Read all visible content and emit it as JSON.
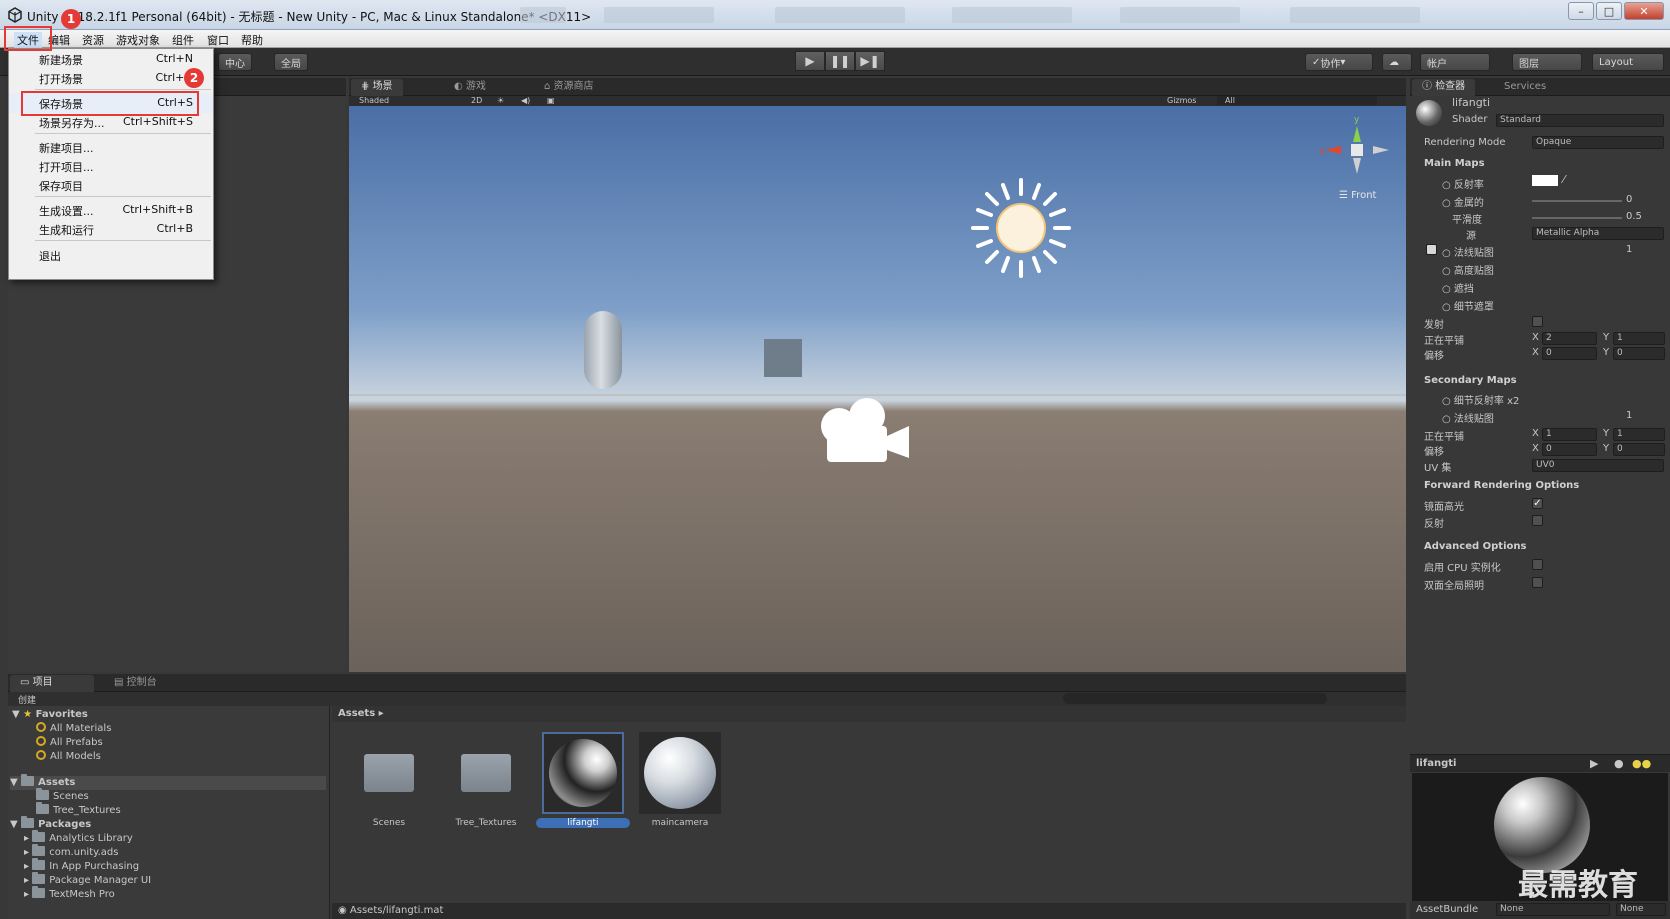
{
  "title_bar": {
    "title": "Unity 2018.2.1f1 Personal (64bit) - 无标题 - New Unity - PC, Mac & Linux Standalone* <DX11>"
  },
  "menu_bar": {
    "items": [
      "文件",
      "编辑",
      "资源",
      "游戏对象",
      "组件",
      "窗口",
      "帮助"
    ]
  },
  "annotations": {
    "step1": "1",
    "step2": "2"
  },
  "file_menu": {
    "items": [
      {
        "label": "新建场景",
        "shortcut": "Ctrl+N"
      },
      {
        "label": "打开场景",
        "shortcut": "Ctrl+O"
      },
      {
        "label": "保存场景",
        "shortcut": "Ctrl+S"
      },
      {
        "label": "场景另存为...",
        "shortcut": "Ctrl+Shift+S"
      },
      {
        "label": "新建项目...",
        "shortcut": ""
      },
      {
        "label": "打开项目...",
        "shortcut": ""
      },
      {
        "label": "保存项目",
        "shortcut": ""
      },
      {
        "label": "生成设置...",
        "shortcut": "Ctrl+Shift+B"
      },
      {
        "label": "生成和运行",
        "shortcut": "Ctrl+B"
      },
      {
        "label": "退出",
        "shortcut": ""
      }
    ]
  },
  "toolbar": {
    "pivot": "中心",
    "space": "全局",
    "collab": "协作",
    "account": "帐户",
    "layers": "图层",
    "layout": "Layout"
  },
  "scene_tabs": {
    "scene": "场景",
    "game": "游戏",
    "store": "资源商店"
  },
  "scene_toolbar": {
    "shading": "Shaded",
    "mode_2d": "2D",
    "gizmos": "Gizmos",
    "search_placeholder": "All"
  },
  "gizmo": {
    "y": "y",
    "x": "x",
    "view": "Front"
  },
  "inspector": {
    "tab": "检查器",
    "services_tab": "Services",
    "material_name": "lifangti",
    "shader_label": "Shader",
    "shader_value": "Standard",
    "rendering_mode_label": "Rendering Mode",
    "rendering_mode_value": "Opaque",
    "main_maps": "Main Maps",
    "albedo": "反射率",
    "metallic": "金属的",
    "metallic_value": "0",
    "smoothness": "平滑度",
    "smoothness_value": "0.5",
    "source": "源",
    "source_value": "Metallic Alpha",
    "normal_map": "法线贴图",
    "normal_value": "1",
    "height_map": "高度贴图",
    "occlusion": "遮挡",
    "detail_mask": "细节遮罩",
    "emission": "发射",
    "tiling": "正在平铺",
    "tiling_x": "2",
    "tiling_y": "1",
    "offset": "偏移",
    "offset_x": "0",
    "offset_y": "0",
    "secondary_maps": "Secondary Maps",
    "detail_albedo": "细节反射率 x2",
    "sec_normal": "法线贴图",
    "sec_normal_value": "1",
    "sec_tiling_x": "1",
    "sec_tiling_y": "1",
    "sec_offset_x": "0",
    "sec_offset_y": "0",
    "uv_set": "UV 集",
    "uv_value": "UV0",
    "forward_options": "Forward Rendering Options",
    "specular_highlights": "镜面高光",
    "reflections": "反射",
    "advanced_options": "Advanced Options",
    "gpu_instancing": "启用 CPU 实例化",
    "double_sided_gi": "双面全局照明",
    "axis_x": "X",
    "axis_y": "Y",
    "preview_title": "lifangti",
    "assetbundle_label": "AssetBundle",
    "assetbundle_value": "None",
    "assetbundle_variant": "None"
  },
  "project": {
    "tab": "项目",
    "console_tab": "控制台",
    "create": "创建",
    "favorites": "Favorites",
    "fav_items": [
      "All Materials",
      "All Prefabs",
      "All Models"
    ],
    "assets": "Assets",
    "asset_folders": [
      "Scenes",
      "Tree_Textures"
    ],
    "packages": "Packages",
    "package_items": [
      "Analytics Library",
      "com.unity.ads",
      "In App Purchasing",
      "Package Manager UI",
      "TextMesh Pro"
    ],
    "breadcrumb": "Assets",
    "tiles": [
      "Scenes",
      "Tree_Textures",
      "lifangti",
      "maincamera"
    ],
    "status_path": "Assets/lifangti.mat"
  },
  "watermark": "最需教育",
  "colors": {
    "highlight": "#e53935",
    "selection": "#3d6fb6"
  }
}
